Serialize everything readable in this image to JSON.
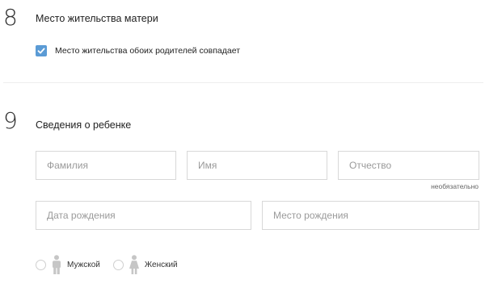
{
  "sections": {
    "mother_residence": {
      "number": "8",
      "title": "Место жительства матери",
      "same_residence_checkbox": {
        "label": "Место жительства обоих родителей совпадает",
        "checked": true
      }
    },
    "child_info": {
      "number": "9",
      "title": "Сведения о ребенке",
      "fields": {
        "surname": {
          "placeholder": "Фамилия",
          "value": ""
        },
        "name": {
          "placeholder": "Имя",
          "value": ""
        },
        "patronymic": {
          "placeholder": "Отчество",
          "value": ""
        },
        "patronymic_note": "необязательно",
        "birth_date": {
          "placeholder": "Дата рождения",
          "value": ""
        },
        "birth_place": {
          "placeholder": "Место рождения",
          "value": ""
        }
      },
      "gender": {
        "male": {
          "label": "Мужской",
          "icon": "male-person-icon",
          "selected": false
        },
        "female": {
          "label": "Женский",
          "icon": "female-person-icon",
          "selected": false
        }
      }
    }
  },
  "colors": {
    "accent": "#5b9bd5",
    "border": "#d8d8d8",
    "placeholder": "#9a9a9a",
    "icon": "#c6c6c6"
  }
}
